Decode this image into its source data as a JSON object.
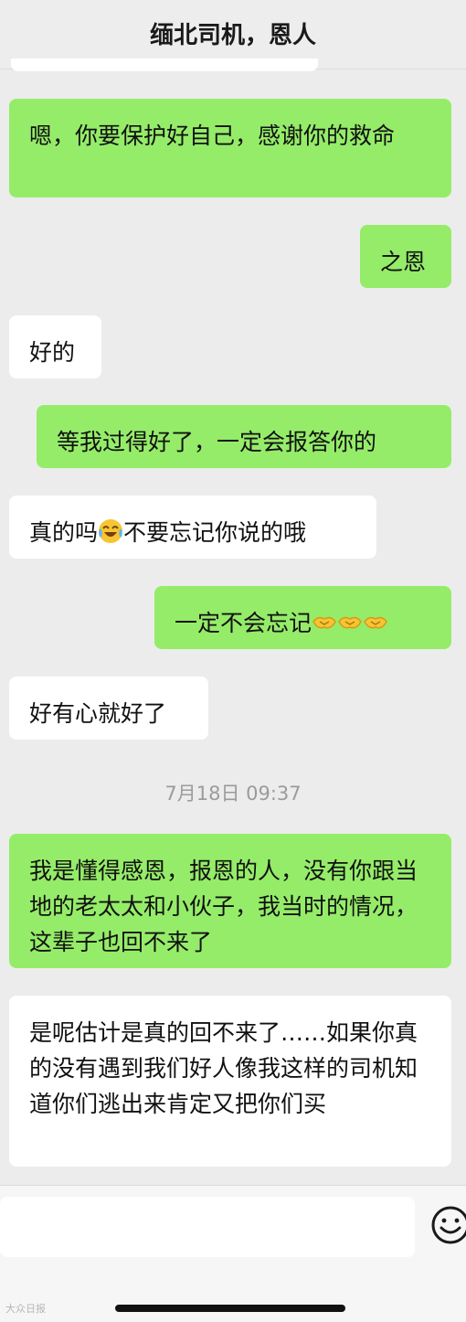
{
  "header": {
    "title": "缅北司机，恩人"
  },
  "messages": [
    {
      "side": "sent",
      "text": "嗯，你要保护好自己，感谢你的救命"
    },
    {
      "side": "sent",
      "text": "之恩"
    },
    {
      "side": "received",
      "text": "好的"
    },
    {
      "side": "sent",
      "text": "等我过得好了，一定会报答你的"
    },
    {
      "side": "received",
      "text_before": "真的吗",
      "emoji": "tears-of-joy",
      "text_after": "不要忘记你说的哦"
    },
    {
      "side": "sent",
      "text": "一定不会忘记",
      "emoji": "handshake",
      "emoji_count": 3
    },
    {
      "side": "received",
      "text": "好有心就好了"
    },
    {
      "side": "sent",
      "text": "我是懂得感恩，报恩的人，没有你跟当地的老太太和小伙子，我当时的情况，这辈子也回不来了"
    },
    {
      "side": "received",
      "text": "是呢估计是真的回不来了……如果你真的没有遇到我们好人像我这样的司机知道你们逃出来肯定又把你们买"
    }
  ],
  "timestamp": "7月18日 09:37",
  "input": {
    "placeholder": "",
    "emoji_icon": "smiley-face"
  },
  "watermark": "大众日报",
  "colors": {
    "sent_bubble": "#95ec69",
    "received_bubble": "#ffffff",
    "background": "#ececec"
  }
}
